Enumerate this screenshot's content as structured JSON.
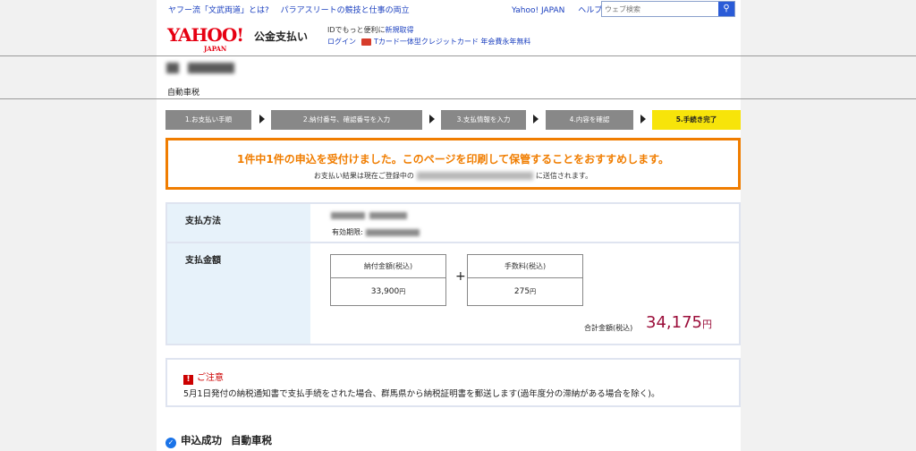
{
  "topbar": {
    "links": [
      "ヤフー流「文武両道」とは?",
      "パラアスリートの競技と仕事の両立"
    ],
    "right_links": [
      "Yahoo! JAPAN",
      "ヘルプ"
    ],
    "search_placeholder": "ウェブ検索"
  },
  "header": {
    "logo": "YAHOO!",
    "logo_sub": "JAPAN",
    "service": "公金支払い",
    "id_text": "IDでもっと便利に",
    "id_link": "新規取得",
    "login": "ログイン",
    "tcard_text": "Tカード一体型クレジットカード 年会費永年無料"
  },
  "section_title": "自動車税",
  "steps": [
    {
      "label": "1.お支払い手順"
    },
    {
      "label": "2.納付番号、確認番号を入力"
    },
    {
      "label": "3.支払情報を入力"
    },
    {
      "label": "4.内容を確認"
    },
    {
      "label": "5.手続き完了"
    }
  ],
  "notice": {
    "main": "1件中1件の申込を受付けました。このページを印刷して保管することをおすすめします。",
    "sub_prefix": "お支払い結果は現在ご登録中の",
    "sub_suffix": "に送信されます。"
  },
  "payment": {
    "method_label": "支払方法",
    "expiry_label": "有効期限:",
    "amount_label": "支払金額",
    "tax_label": "納付金額(税込)",
    "tax_value": "33,900",
    "fee_label": "手数料(税込)",
    "fee_value": "275",
    "yen": "円",
    "plus": "+",
    "total_label": "合計金額(税込)",
    "total_value": "34,175"
  },
  "caution": {
    "title": "ご注意",
    "text": "5月1日発付の納税通知書で支払手続をされた場合、群馬県から納税証明書を郵送します(過年度分の滞納がある場合を除く)。"
  },
  "success": {
    "label": "申込成功",
    "item": "自動車税"
  }
}
